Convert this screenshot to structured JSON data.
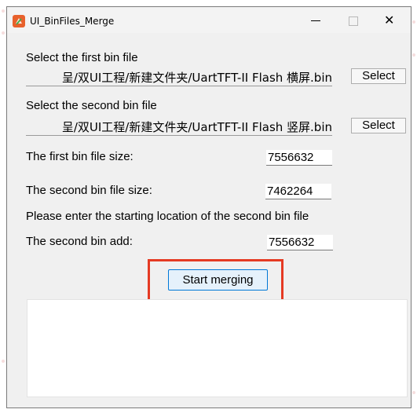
{
  "window": {
    "title": "UI_BinFiles_Merge",
    "accent_color": "#0078d7",
    "icon": "app-logo-icon"
  },
  "first_bin": {
    "label": "Select the first bin file",
    "path": "呈/双UI工程/新建文件夹/UartTFT-II Flash 横屏.bin",
    "button": "Select"
  },
  "second_bin": {
    "label": "Select the second bin file",
    "path": "呈/双UI工程/新建文件夹/UartTFT-II Flash 竖屏.bin",
    "button": "Select"
  },
  "sizes": {
    "first_label": "The first bin file size:",
    "first_value": "7556632",
    "second_label": "The second bin file size:",
    "second_value": "7462264"
  },
  "start_location": {
    "prompt": "Please enter the starting location of the second bin file",
    "add_label": "The second bin add:",
    "add_value": "7556632"
  },
  "actions": {
    "start_label": "Start merging",
    "highlight_color": "#e53a23"
  },
  "log": {
    "text": ""
  }
}
